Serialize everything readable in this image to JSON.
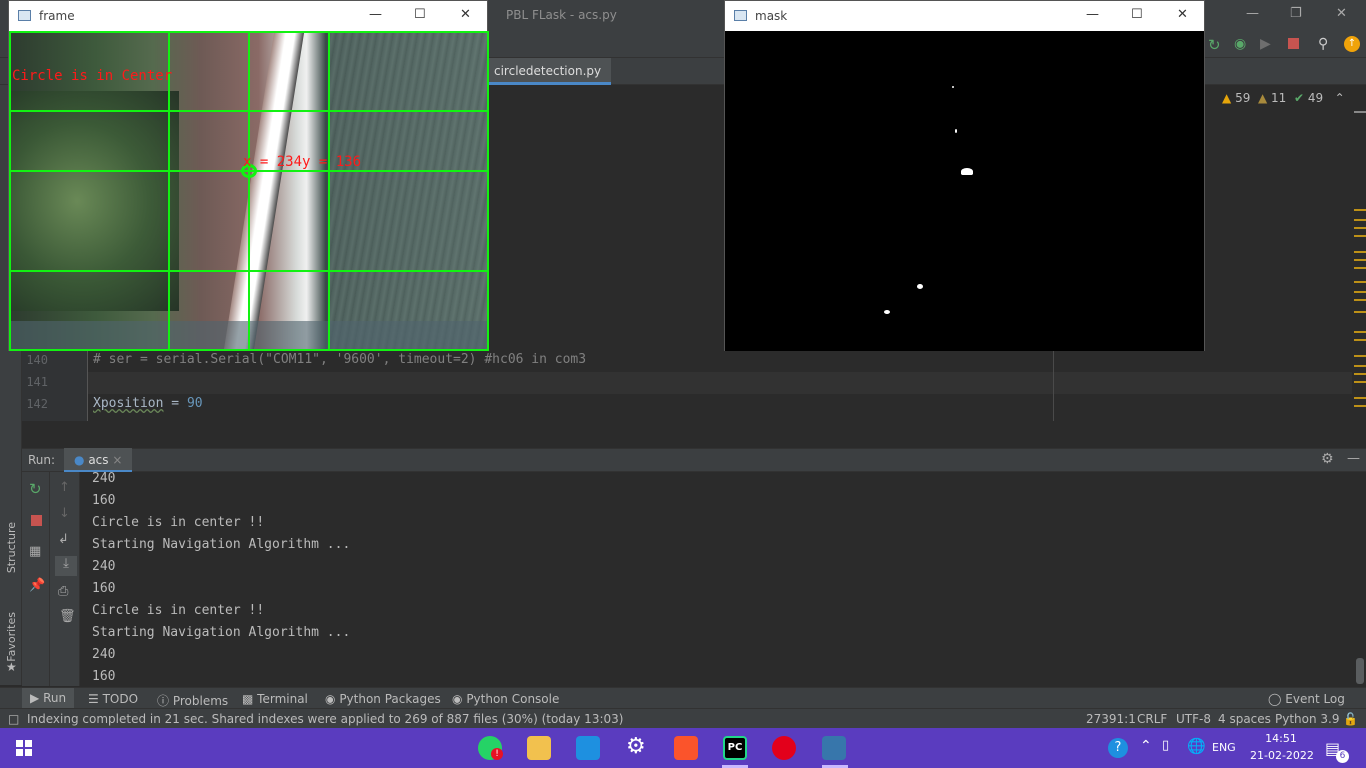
{
  "ide": {
    "title": "PBL FLask - acs.py",
    "active_tab": "circledetection.py",
    "inspections": {
      "warnings": "59",
      "weak_warnings": "11",
      "typos": "49"
    }
  },
  "editor": {
    "lines": [
      {
        "num": "140",
        "text": "# ser = serial.Serial(\"COM11\", '9600', timeout=2) #hc06 in com3"
      },
      {
        "num": "141",
        "text": ""
      },
      {
        "num": "142",
        "var": "Xposition",
        "op": " = ",
        "val": "90"
      }
    ]
  },
  "sidebar": {
    "structure": "Structure",
    "favorites": "Favorites"
  },
  "run_panel": {
    "label": "Run:",
    "tab": "acs",
    "console": [
      "240",
      "160",
      "Circle is in center !!",
      "Starting Navigation Algorithm ...",
      "240",
      "160",
      "Circle is in center !!",
      "Starting Navigation Algorithm ...",
      "240",
      "160"
    ]
  },
  "bottom_tabs": {
    "run": "Run",
    "todo": "TODO",
    "problems": "Problems",
    "terminal": "Terminal",
    "python_packages": "Python Packages",
    "python_console": "Python Console",
    "event_log": "Event Log"
  },
  "status_bar": {
    "message": "Indexing completed in 21 sec. Shared indexes were applied to 269 of 887 files (30%) (today 13:03)",
    "position": "27391:1",
    "line_sep": "CRLF",
    "encoding": "UTF-8",
    "indent": "4 spaces",
    "interpreter": "Python 3.9"
  },
  "frame_window": {
    "title": "frame",
    "overlay_text": "Circle is in Center",
    "coord_text": "x = 234y = 136",
    "overlay_color": "#ff1a1a",
    "grid_color": "#12f212"
  },
  "mask_window": {
    "title": "mask"
  },
  "taskbar": {
    "language": "ENG",
    "time": "14:51",
    "date": "21-02-2022",
    "notification_count": "6",
    "color": "#5a3cbf"
  }
}
